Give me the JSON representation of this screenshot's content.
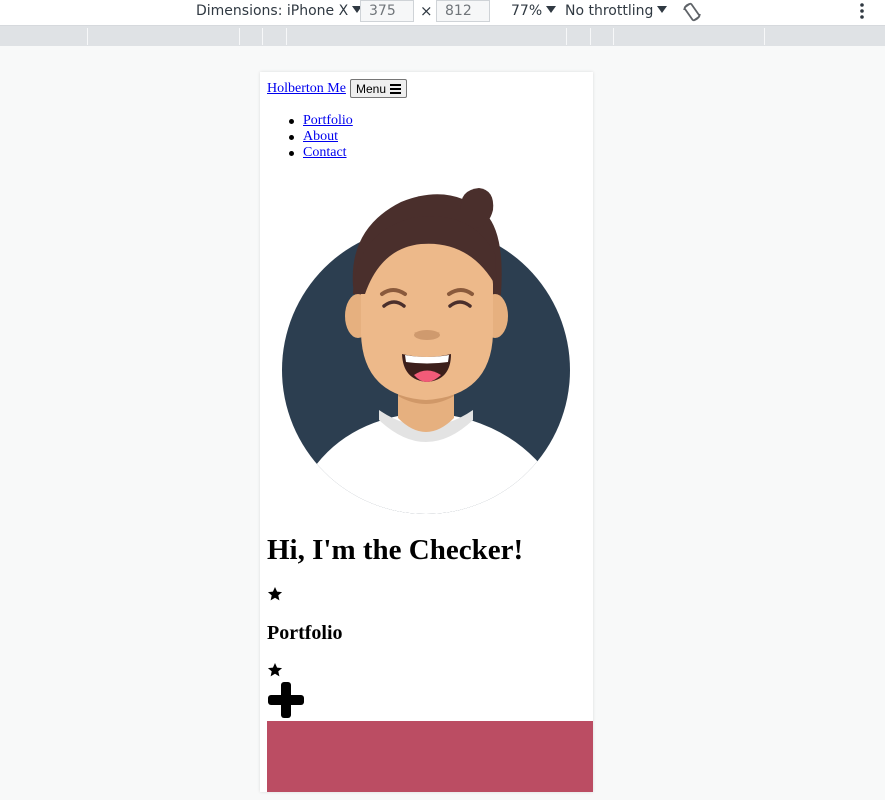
{
  "devtools": {
    "device_label": "Dimensions: iPhone X",
    "width_value": "375",
    "times_sign": "×",
    "height_value": "812",
    "zoom": "77%",
    "throttling": "No throttling",
    "rotate_icon": "rotate-icon",
    "more_icon": "more-vertical-icon"
  },
  "page": {
    "brand": "Holberton Me",
    "menu_button": "Menu",
    "nav": [
      {
        "label": "Portfolio"
      },
      {
        "label": "About"
      },
      {
        "label": "Contact"
      }
    ],
    "hero_title": "Hi, I'm the Checker!",
    "section_title": "Portfolio",
    "icons": [
      "star-icon",
      "plus-icon",
      "hamburger-icon"
    ],
    "colors": {
      "avatar_background": "#2c3e50",
      "accent_block": "#bb4d63",
      "link": "#0000ee"
    }
  }
}
